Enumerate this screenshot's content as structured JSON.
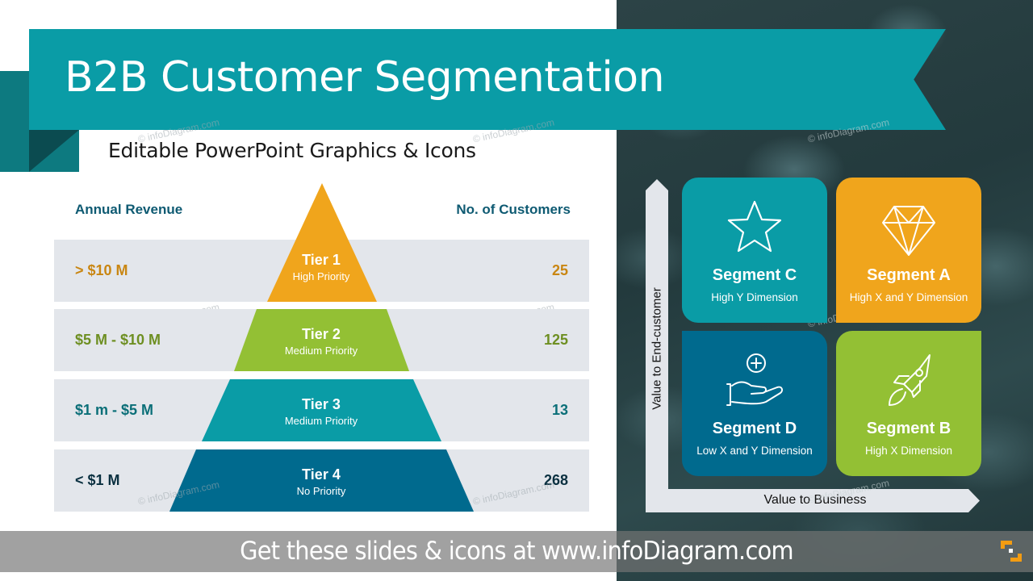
{
  "header": {
    "title": "B2B Customer Segmentation",
    "subtitle": "Editable PowerPoint Graphics & Icons"
  },
  "watermark": "© infoDiagram.com",
  "pyramid": {
    "left_header": "Annual Revenue",
    "right_header": "No. of Customers",
    "tiers": [
      {
        "name": "Tier 1",
        "priority": "High Priority",
        "revenue": "> $10 M",
        "customers": "25",
        "color": "#f0a51c",
        "text_color": "#c98612"
      },
      {
        "name": "Tier 2",
        "priority": "Medium Priority",
        "revenue": "$5 M - $10 M",
        "customers": "125",
        "color": "#93c034",
        "text_color": "#6e8f22"
      },
      {
        "name": "Tier 3",
        "priority": "Medium Priority",
        "revenue": "$1 m - $5 M",
        "customers": "13",
        "color": "#0a9ca6",
        "text_color": "#0b6f78"
      },
      {
        "name": "Tier 4",
        "priority": "No Priority",
        "revenue": "< $1 M",
        "customers": "268",
        "color": "#006a8e",
        "text_color": "#0a3040"
      }
    ]
  },
  "matrix": {
    "y_axis_label": "Value to End-customer",
    "x_axis_label": "Value to Business",
    "segments": [
      {
        "id": "C",
        "name": "Segment C",
        "description": "High Y Dimension",
        "icon": "star-icon",
        "color": "#0a9ca6"
      },
      {
        "id": "A",
        "name": "Segment A",
        "description": "High X and Y Dimension",
        "icon": "diamond-icon",
        "color": "#f0a51c"
      },
      {
        "id": "D",
        "name": "Segment D",
        "description": "Low X and Y Dimension",
        "icon": "hand-plus-icon",
        "color": "#006a8e"
      },
      {
        "id": "B",
        "name": "Segment B",
        "description": "High X Dimension",
        "icon": "rocket-icon",
        "color": "#93c034"
      }
    ]
  },
  "footer": {
    "text": "Get these slides & icons at www.infoDiagram.com",
    "logo_color": "#f39c12"
  }
}
